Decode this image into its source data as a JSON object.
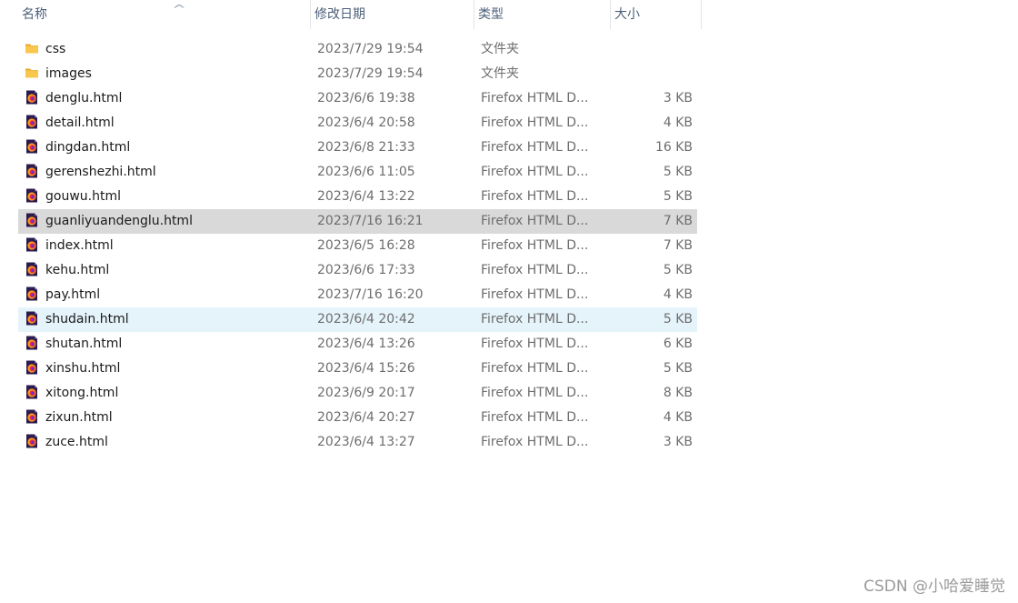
{
  "columns": {
    "name": "名称",
    "date": "修改日期",
    "type": "类型",
    "size": "大小"
  },
  "sort_indicator": "^",
  "files": [
    {
      "name": "css",
      "date": "2023/7/29 19:54",
      "type": "文件夹",
      "size": "",
      "kind": "folder"
    },
    {
      "name": "images",
      "date": "2023/7/29 19:54",
      "type": "文件夹",
      "size": "",
      "kind": "folder"
    },
    {
      "name": "denglu.html",
      "date": "2023/6/6 19:38",
      "type": "Firefox HTML D...",
      "size": "3 KB",
      "kind": "html"
    },
    {
      "name": "detail.html",
      "date": "2023/6/4 20:58",
      "type": "Firefox HTML D...",
      "size": "4 KB",
      "kind": "html"
    },
    {
      "name": "dingdan.html",
      "date": "2023/6/8 21:33",
      "type": "Firefox HTML D...",
      "size": "16 KB",
      "kind": "html"
    },
    {
      "name": "gerenshezhi.html",
      "date": "2023/6/6 11:05",
      "type": "Firefox HTML D...",
      "size": "5 KB",
      "kind": "html"
    },
    {
      "name": "gouwu.html",
      "date": "2023/6/4 13:22",
      "type": "Firefox HTML D...",
      "size": "5 KB",
      "kind": "html"
    },
    {
      "name": "guanliyuandenglu.html",
      "date": "2023/7/16 16:21",
      "type": "Firefox HTML D...",
      "size": "7 KB",
      "kind": "html",
      "state": "selected"
    },
    {
      "name": "index.html",
      "date": "2023/6/5 16:28",
      "type": "Firefox HTML D...",
      "size": "7 KB",
      "kind": "html"
    },
    {
      "name": "kehu.html",
      "date": "2023/6/6 17:33",
      "type": "Firefox HTML D...",
      "size": "5 KB",
      "kind": "html"
    },
    {
      "name": "pay.html",
      "date": "2023/7/16 16:20",
      "type": "Firefox HTML D...",
      "size": "4 KB",
      "kind": "html"
    },
    {
      "name": "shudain.html",
      "date": "2023/6/4 20:42",
      "type": "Firefox HTML D...",
      "size": "5 KB",
      "kind": "html",
      "state": "hover"
    },
    {
      "name": "shutan.html",
      "date": "2023/6/4 13:26",
      "type": "Firefox HTML D...",
      "size": "6 KB",
      "kind": "html"
    },
    {
      "name": "xinshu.html",
      "date": "2023/6/4 15:26",
      "type": "Firefox HTML D...",
      "size": "5 KB",
      "kind": "html"
    },
    {
      "name": "xitong.html",
      "date": "2023/6/9 20:17",
      "type": "Firefox HTML D...",
      "size": "8 KB",
      "kind": "html"
    },
    {
      "name": "zixun.html",
      "date": "2023/6/4 20:27",
      "type": "Firefox HTML D...",
      "size": "4 KB",
      "kind": "html"
    },
    {
      "name": "zuce.html",
      "date": "2023/6/4 13:27",
      "type": "Firefox HTML D...",
      "size": "3 KB",
      "kind": "html"
    }
  ],
  "icons": {
    "folder": "folder-icon",
    "html": "firefox-html-file-icon"
  },
  "colors": {
    "selected_row": "#d9d9d9",
    "hover_row": "#e5f3fb",
    "folder_yellow": "#f8c74e",
    "header_text": "#4c607a"
  },
  "watermark": "CSDN @小哈爱睡觉"
}
